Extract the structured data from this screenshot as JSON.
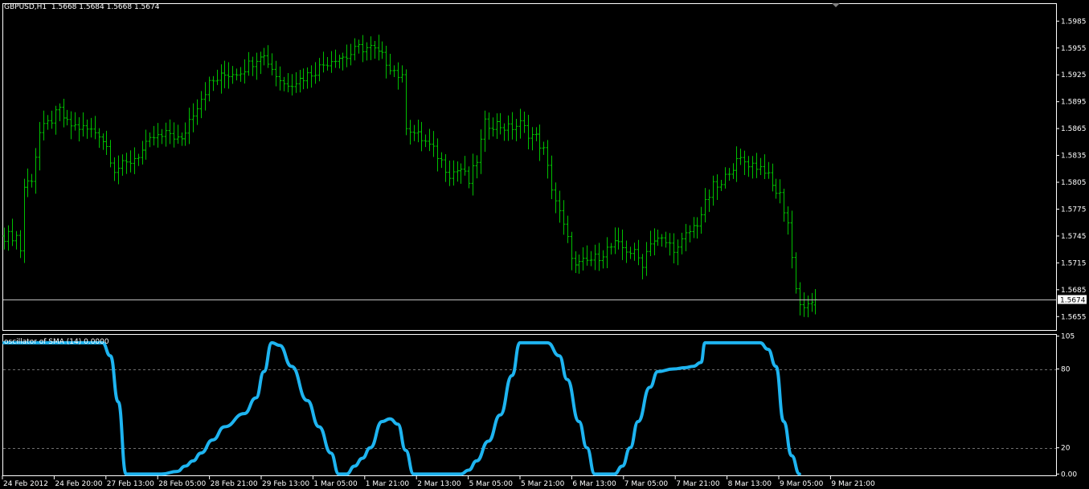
{
  "header": {
    "symbol": "GBPUSD,H1",
    "ohlc": "1.5668 1.5684 1.5668 1.5674"
  },
  "current_price_label": "1.5674",
  "oscillator": {
    "title": "oscillator of SMA (14) 0.0000"
  },
  "colors": {
    "background": "#000000",
    "bars": "#00c000",
    "oscillator_line": "#1eb4f0",
    "frame": "#ffffff",
    "level_lines": "#6e6e6e"
  },
  "chart_data": [
    {
      "type": "ohlc",
      "title": "GBPUSD,H1",
      "timeframe": "H1",
      "y_ticks": [
        "1.5985",
        "1.5955",
        "1.5925",
        "1.5895",
        "1.5865",
        "1.5835",
        "1.5805",
        "1.5775",
        "1.5745",
        "1.5715",
        "1.5685",
        "1.5655"
      ],
      "ylim": [
        1.564,
        1.6005
      ],
      "x_ticks": [
        "24 Feb 2012",
        "24 Feb 20:00",
        "27 Feb 13:00",
        "28 Feb 05:00",
        "28 Feb 21:00",
        "29 Feb 13:00",
        "1 Mar 05:00",
        "1 Mar 21:00",
        "2 Mar 13:00",
        "5 Mar 05:00",
        "5 Mar 21:00",
        "6 Mar 13:00",
        "7 Mar 05:00",
        "7 Mar 21:00",
        "8 Mar 13:00",
        "9 Mar 05:00",
        "9 Mar 21:00"
      ],
      "close_path": [
        [
          0,
          1.5745
        ],
        [
          3,
          1.5745
        ],
        [
          4,
          1.573
        ],
        [
          5,
          1.58
        ],
        [
          7,
          1.581
        ],
        [
          9,
          1.586
        ],
        [
          11,
          1.587
        ],
        [
          14,
          1.5885
        ],
        [
          16,
          1.587
        ],
        [
          20,
          1.5865
        ],
        [
          24,
          1.586
        ],
        [
          26,
          1.5845
        ],
        [
          28,
          1.582
        ],
        [
          31,
          1.5825
        ],
        [
          35,
          1.584
        ],
        [
          38,
          1.5855
        ],
        [
          40,
          1.5855
        ],
        [
          42,
          1.586
        ],
        [
          45,
          1.585
        ],
        [
          47,
          1.5875
        ],
        [
          50,
          1.59
        ],
        [
          52,
          1.5915
        ],
        [
          56,
          1.5925
        ],
        [
          60,
          1.593
        ],
        [
          63,
          1.594
        ],
        [
          65,
          1.595
        ],
        [
          67,
          1.594
        ],
        [
          69,
          1.5925
        ],
        [
          71,
          1.5915
        ],
        [
          75,
          1.592
        ],
        [
          79,
          1.593
        ],
        [
          82,
          1.594
        ],
        [
          84,
          1.5945
        ],
        [
          87,
          1.5945
        ],
        [
          90,
          1.5955
        ],
        [
          93,
          1.5955
        ],
        [
          96,
          1.5945
        ],
        [
          99,
          1.593
        ],
        [
          101,
          1.592
        ],
        [
          102,
          1.587
        ],
        [
          104,
          1.586
        ],
        [
          107,
          1.585
        ],
        [
          110,
          1.5835
        ],
        [
          113,
          1.5815
        ],
        [
          116,
          1.582
        ],
        [
          118,
          1.5805
        ],
        [
          120,
          1.583
        ],
        [
          122,
          1.587
        ],
        [
          125,
          1.587
        ],
        [
          128,
          1.5865
        ],
        [
          131,
          1.587
        ],
        [
          133,
          1.586
        ],
        [
          135,
          1.5855
        ],
        [
          137,
          1.584
        ],
        [
          139,
          1.58
        ],
        [
          141,
          1.577
        ],
        [
          143,
          1.574
        ],
        [
          145,
          1.571
        ],
        [
          147,
          1.5715
        ],
        [
          150,
          1.572
        ],
        [
          153,
          1.573
        ],
        [
          155,
          1.5735
        ],
        [
          158,
          1.573
        ],
        [
          160,
          1.5725
        ],
        [
          162,
          1.5715
        ],
        [
          164,
          1.574
        ],
        [
          167,
          1.574
        ],
        [
          169,
          1.5735
        ],
        [
          171,
          1.573
        ],
        [
          173,
          1.5745
        ],
        [
          176,
          1.576
        ],
        [
          178,
          1.578
        ],
        [
          180,
          1.58
        ],
        [
          182,
          1.58
        ],
        [
          184,
          1.582
        ],
        [
          187,
          1.583
        ],
        [
          190,
          1.5825
        ],
        [
          193,
          1.582
        ],
        [
          195,
          1.58
        ],
        [
          197,
          1.579
        ],
        [
          199,
          1.576
        ],
        [
          200,
          1.572
        ],
        [
          201,
          1.569
        ],
        [
          202,
          1.5668
        ],
        [
          204,
          1.5665
        ],
        [
          206,
          1.5674
        ]
      ]
    },
    {
      "type": "line",
      "title": "oscillator of SMA (14) 0.0000",
      "y_ticks": [
        "105",
        "80",
        "20",
        "0.00"
      ],
      "ylim": [
        -1,
        106
      ],
      "levels": [
        80,
        20
      ],
      "series": [
        {
          "x": [
            0,
            25,
            27,
            29,
            31,
            33,
            35,
            37,
            40,
            44,
            46,
            48,
            50,
            53,
            56,
            61,
            64,
            66,
            68,
            70,
            73,
            77,
            80,
            83,
            85,
            87,
            89,
            91,
            93,
            96,
            98,
            100,
            102,
            104,
            106,
            116,
            118,
            120,
            123,
            126,
            129,
            131,
            132,
            138,
            141,
            143,
            146,
            148,
            150,
            153,
            155,
            157,
            159,
            161,
            164,
            166,
            170,
            173,
            175,
            177,
            178,
            188,
            190,
            192,
            194,
            196,
            198,
            200,
            202
          ],
          "values": [
            100,
            100,
            90,
            55,
            0,
            0,
            0,
            0,
            0,
            2,
            6,
            10,
            16,
            26,
            36,
            46,
            58,
            78,
            100,
            98,
            82,
            56,
            36,
            16,
            0,
            0,
            6,
            12,
            20,
            40,
            42,
            38,
            18,
            0,
            0,
            0,
            3,
            10,
            25,
            45,
            75,
            100,
            100,
            100,
            90,
            72,
            40,
            20,
            0,
            0,
            0,
            6,
            20,
            40,
            66,
            78,
            80,
            81,
            82,
            85,
            100,
            100,
            100,
            100,
            95,
            82,
            40,
            14,
            0
          ]
        }
      ]
    }
  ]
}
